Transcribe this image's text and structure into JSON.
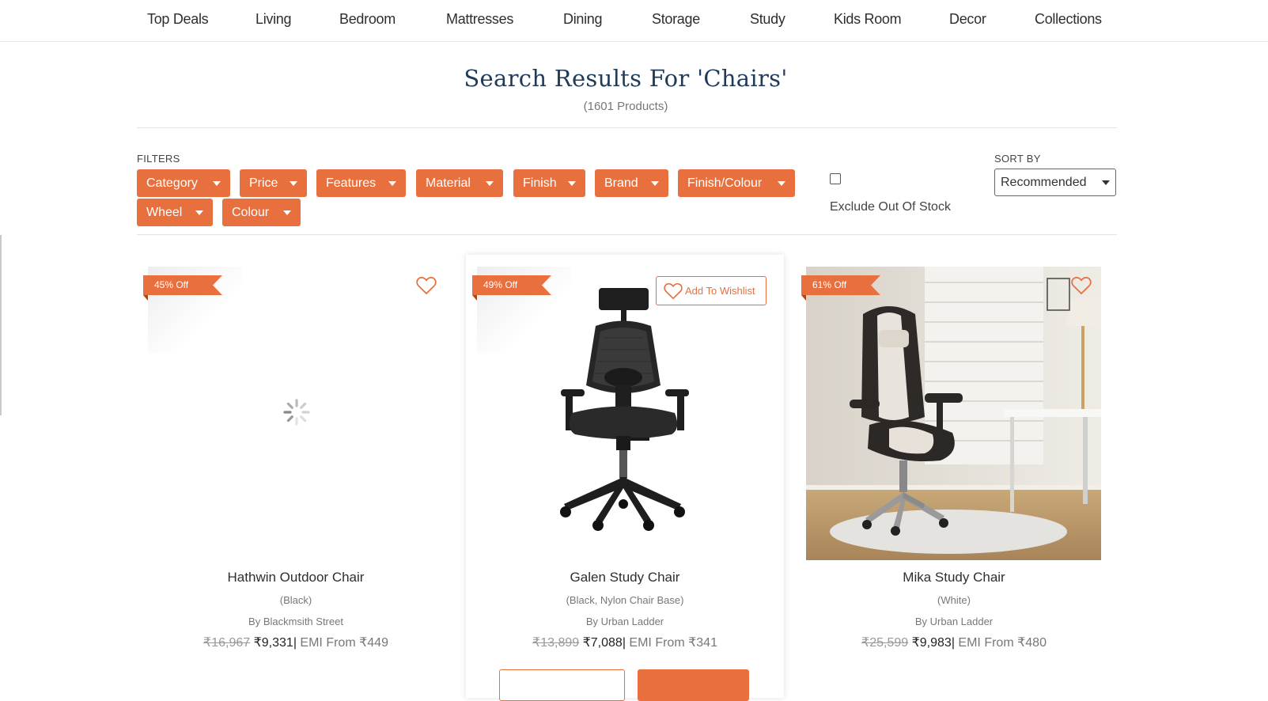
{
  "nav": {
    "items": [
      {
        "label": "Top Deals"
      },
      {
        "label": "Living"
      },
      {
        "label": "Bedroom"
      },
      {
        "label": "Mattresses"
      },
      {
        "label": "Dining"
      },
      {
        "label": "Storage"
      },
      {
        "label": "Study"
      },
      {
        "label": "Kids Room"
      },
      {
        "label": "Decor"
      },
      {
        "label": "Collections"
      }
    ]
  },
  "search": {
    "title": "Search Results For 'Chairs'",
    "count": "(1601 Products)"
  },
  "filters": {
    "label": "FILTERS",
    "items": [
      {
        "label": "Category"
      },
      {
        "label": "Price"
      },
      {
        "label": "Features"
      },
      {
        "label": "Material"
      },
      {
        "label": "Finish"
      },
      {
        "label": "Brand"
      },
      {
        "label": "Finish/Colour"
      },
      {
        "label": "Wheel"
      },
      {
        "label": "Colour"
      }
    ],
    "exclude_label": "Exclude Out Of Stock",
    "exclude_checked": false
  },
  "sort": {
    "label": "SORT BY",
    "selected": "Recommended"
  },
  "colors": {
    "accent": "#e8703f",
    "title": "#1f3a5a"
  },
  "products": [
    {
      "discount": "45% Off",
      "name": "Hathwin Outdoor Chair",
      "variant": "(Black)",
      "brand": "By Blackmsith Street",
      "mrp": "₹16,967",
      "price": "₹9,331",
      "separator": "|",
      "emi": "EMI From ₹449",
      "image": "loading-spinner"
    },
    {
      "discount": "49% Off",
      "name": "Galen Study Chair",
      "variant": "(Black, Nylon Chair Base)",
      "brand": "By Urban Ladder",
      "mrp": "₹13,899",
      "price": "₹7,088",
      "separator": "|",
      "emi": "EMI From ₹341",
      "wishlist_label": "Add To Wishlist",
      "image": "black-mesh-office-chair"
    },
    {
      "discount": "61% Off",
      "name": "Mika Study Chair",
      "variant": "(White)",
      "brand": "By Urban Ladder",
      "mrp": "₹25,599",
      "price": "₹9,983",
      "separator": "|",
      "emi": "EMI From ₹480",
      "image": "gaming-chair-room-photo"
    }
  ]
}
